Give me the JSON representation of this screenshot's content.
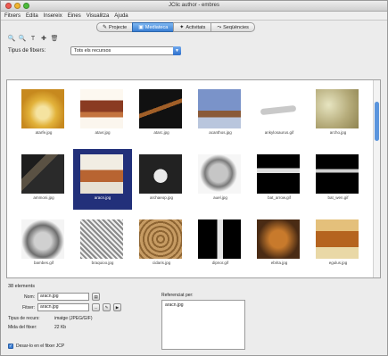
{
  "window": {
    "title": "JClic author - embres",
    "lights": [
      "#ef5b52",
      "#f1b530",
      "#4cbc3a"
    ]
  },
  "menu": [
    "Fitxers",
    "Edita",
    "Insereix",
    "Eines",
    "Visualitza",
    "Ajuda"
  ],
  "tabs": [
    {
      "label": "Projecte",
      "icon": "✎",
      "active": false
    },
    {
      "label": "Mediateca",
      "icon": "▣",
      "active": true
    },
    {
      "label": "Activitats",
      "icon": "✦",
      "active": false
    },
    {
      "label": "Seqüències",
      "icon": "⤳",
      "active": false
    }
  ],
  "toolbar": [
    "🔍",
    "🔍",
    "T",
    "✚",
    "🗑"
  ],
  "filter": {
    "label": "Tipus de fitxers:",
    "value": "Tots els recursos"
  },
  "media": [
    {
      "name": "atarfe.jpg"
    },
    {
      "name": "atavr.jpg"
    },
    {
      "name": "atarc.jpg"
    },
    {
      "name": "acanthos.jpg"
    },
    {
      "name": "ankylosaurus.gif"
    },
    {
      "name": "archo.jpg"
    },
    {
      "name": "ammoni.jpg"
    },
    {
      "name": "aracn.jpg"
    },
    {
      "name": "archaeop.jpg"
    },
    {
      "name": "auel.jpg"
    },
    {
      "name": "bat_arrow.gif"
    },
    {
      "name": "bat_wen.gif"
    },
    {
      "name": "bambes.gif"
    },
    {
      "name": "braquioo.jpg"
    },
    {
      "name": "cidaris.jpg"
    },
    {
      "name": "dipnor.gif"
    },
    {
      "name": "ebrita.jpg"
    },
    {
      "name": "egulus.jpg"
    }
  ],
  "selected_index": 7,
  "details": {
    "count_label": "38 elements",
    "name_label": "Nom:",
    "name_value": "aracn.jpg",
    "file_label": "Fitxer:",
    "file_value": "aracn.jpg",
    "type_label": "Tipus de recurs:",
    "type_value": "imatge (JPEG/GIF)",
    "size_label": "Mida del fitxer:",
    "size_value": "22 Kb",
    "save_label": "Desar-lo en el fitxer JCP",
    "save_checked": true,
    "edit_button": "▤",
    "file_buttons": [
      "...",
      "✎",
      "▶"
    ]
  },
  "references": {
    "label": "Referenciat per:",
    "items": [
      "aracn.jpg"
    ]
  }
}
